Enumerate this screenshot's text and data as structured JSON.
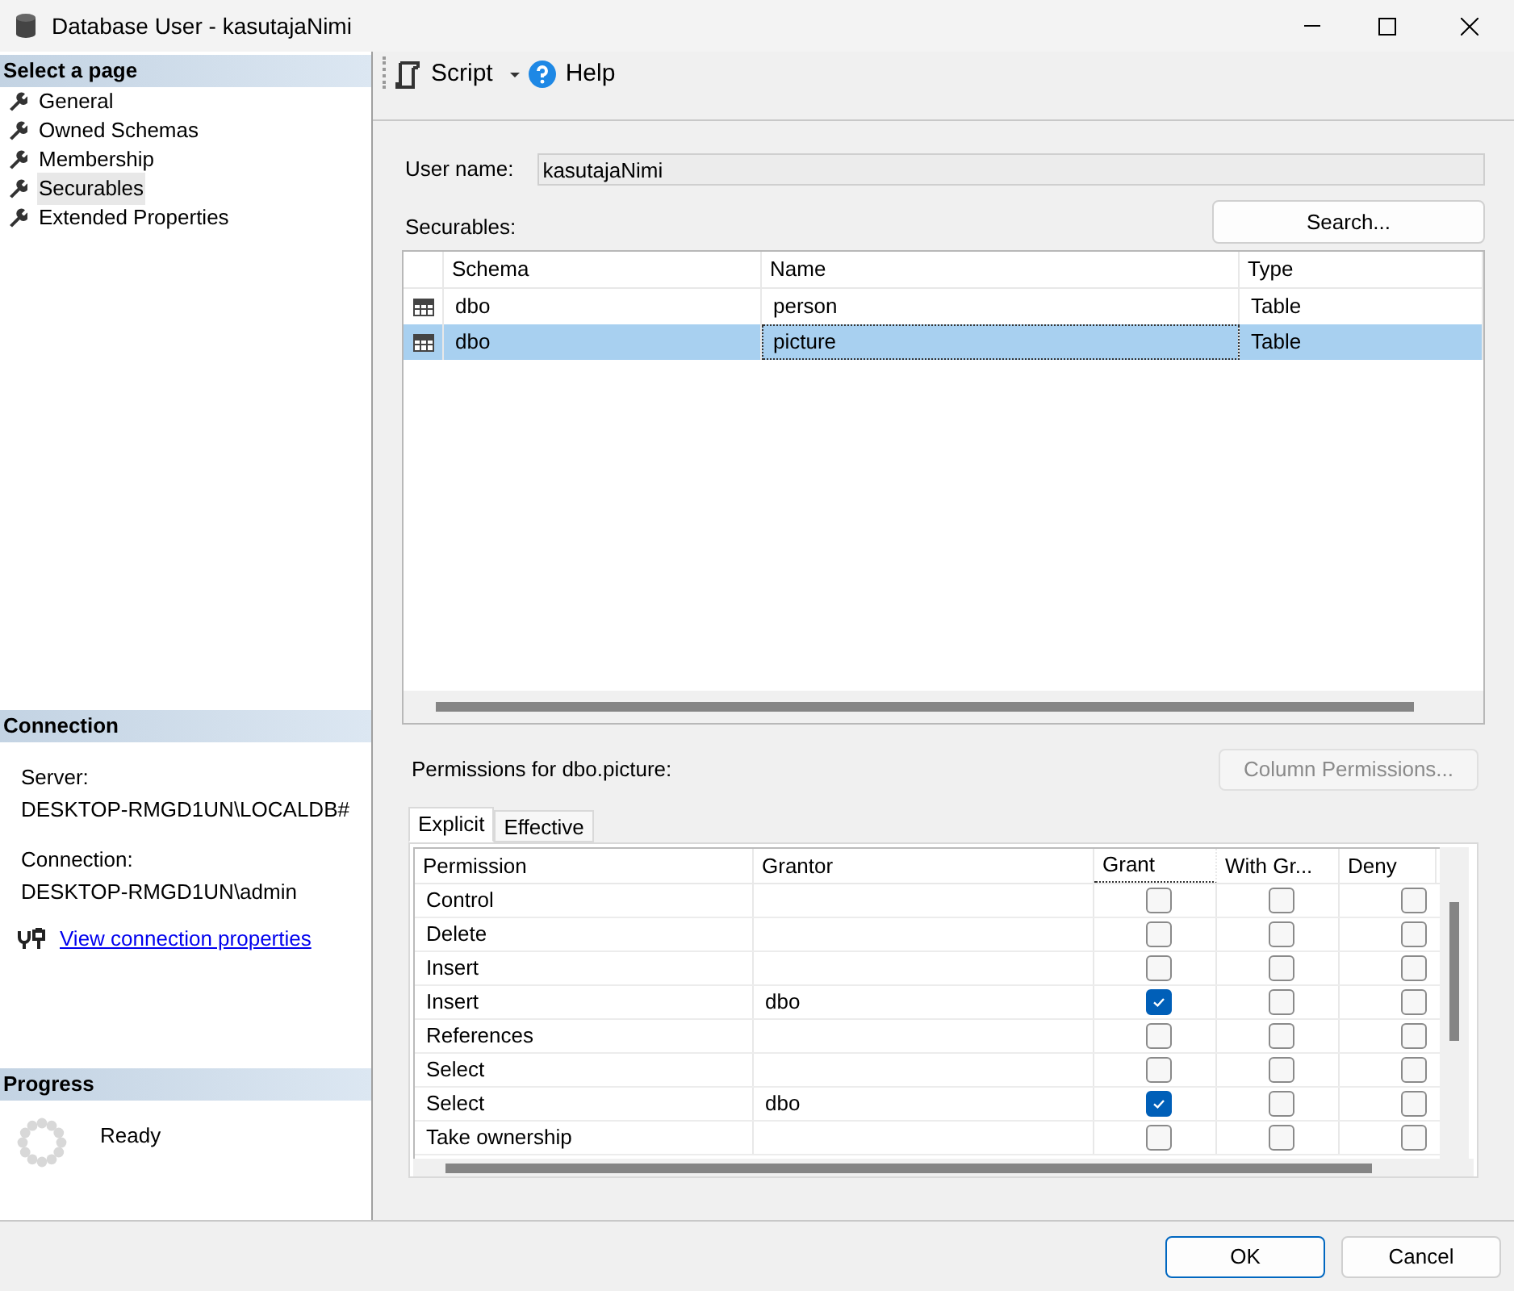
{
  "window": {
    "title": "Database User - kasutajaNimi"
  },
  "sidebar": {
    "header": "Select a page",
    "items": [
      {
        "label": "General",
        "selected": false
      },
      {
        "label": "Owned Schemas",
        "selected": false
      },
      {
        "label": "Membership",
        "selected": false
      },
      {
        "label": "Securables",
        "selected": true
      },
      {
        "label": "Extended Properties",
        "selected": false
      }
    ]
  },
  "connection": {
    "header": "Connection",
    "server_label": "Server:",
    "server": "DESKTOP-RMGD1UN\\LOCALDB#",
    "connection_label": "Connection:",
    "connection": "DESKTOP-RMGD1UN\\admin",
    "link": "View connection properties"
  },
  "progress": {
    "header": "Progress",
    "status": "Ready"
  },
  "toolbar": {
    "script": "Script",
    "help": "Help"
  },
  "user_name": {
    "label": "User name:",
    "value": "kasutajaNimi"
  },
  "securables": {
    "label": "Securables:",
    "search_button": "Search...",
    "columns": [
      "Schema",
      "Name",
      "Type"
    ],
    "rows": [
      {
        "cells": [
          "dbo",
          "person",
          "Table"
        ],
        "selected": false
      },
      {
        "cells": [
          "dbo",
          "picture",
          "Table"
        ],
        "selected": true
      }
    ]
  },
  "permissions": {
    "label": "Permissions for dbo.picture:",
    "column_permissions_button": {
      "label": "Column Permissions...",
      "disabled": true
    },
    "tabs": [
      {
        "label": "Explicit",
        "selected": true
      },
      {
        "label": "Effective",
        "selected": false
      }
    ],
    "columns": [
      "Permission",
      "Grantor",
      "Grant",
      "With Gr...",
      "Deny"
    ],
    "rows": [
      {
        "permission": "Control",
        "grantor": "",
        "grant": false,
        "with_grant": false,
        "deny": false
      },
      {
        "permission": "Delete",
        "grantor": "",
        "grant": false,
        "with_grant": false,
        "deny": false
      },
      {
        "permission": "Insert",
        "grantor": "",
        "grant": false,
        "with_grant": false,
        "deny": false
      },
      {
        "permission": "Insert",
        "grantor": "dbo",
        "grant": true,
        "with_grant": false,
        "deny": false
      },
      {
        "permission": "References",
        "grantor": "",
        "grant": false,
        "with_grant": false,
        "deny": false
      },
      {
        "permission": "Select",
        "grantor": "",
        "grant": false,
        "with_grant": false,
        "deny": false
      },
      {
        "permission": "Select",
        "grantor": "dbo",
        "grant": true,
        "with_grant": false,
        "deny": false
      },
      {
        "permission": "Take ownership",
        "grantor": "",
        "grant": false,
        "with_grant": false,
        "deny": false
      }
    ]
  },
  "buttons": {
    "ok": "OK",
    "cancel": "Cancel"
  }
}
